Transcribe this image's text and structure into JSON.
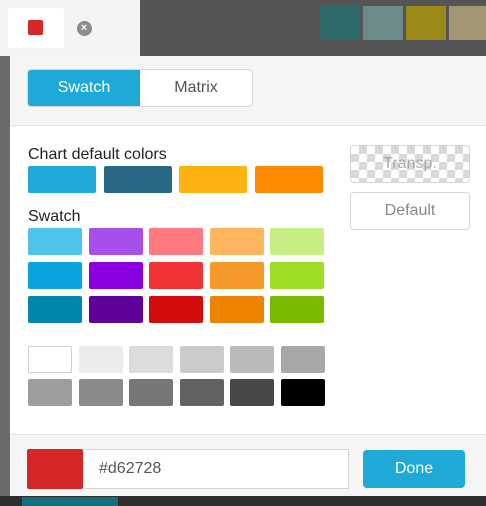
{
  "background": {
    "tiles": [
      "#2f6a6a",
      "#6d8a8a",
      "#9c8a18",
      "#a29572"
    ]
  },
  "tabs": {
    "color_tab_swatch": "#d62728",
    "close_icon": "close-icon"
  },
  "mode_toggle": {
    "swatch_label": "Swatch",
    "matrix_label": "Matrix",
    "active": "Swatch"
  },
  "chart_defaults": {
    "label": "Chart default colors",
    "colors": [
      "#1ea9d6",
      "#2a6785",
      "#ffb20f",
      "#ff8a00"
    ]
  },
  "swatch": {
    "label": "Swatch",
    "rows": [
      [
        "#4fc3ea",
        "#a64fea",
        "#ff7a80",
        "#ffb55e",
        "#c9ed85"
      ],
      [
        "#0aa3e0",
        "#8a00e0",
        "#f03335",
        "#f59a2a",
        "#a0de26"
      ],
      [
        "#0088aa",
        "#5f0098",
        "#d20b0b",
        "#ee8300",
        "#79b900"
      ]
    ],
    "grays": [
      [
        "#ffffff",
        "#ececec",
        "#dcdcdc",
        "#cbcbcb",
        "#bababa",
        "#a8a8a8"
      ],
      [
        "#9d9d9d",
        "#8a8a8a",
        "#767676",
        "#626262",
        "#474747",
        "#000000"
      ]
    ]
  },
  "side_buttons": {
    "transparent_label": "Transp.",
    "default_label": "Default"
  },
  "footer": {
    "selected_color": "#d62728",
    "hex_value": "#d62728",
    "done_label": "Done"
  }
}
